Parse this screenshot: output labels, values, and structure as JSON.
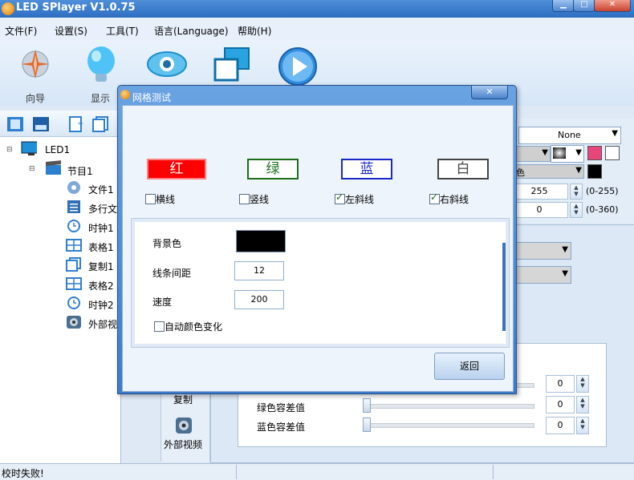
{
  "window": {
    "title": "LED SPlayer V1.0.75",
    "min": "▁",
    "max": "□",
    "close": "✕"
  },
  "menu": [
    "文件(F)",
    "设置(S)",
    "工具(T)",
    "语言(Language)",
    "帮助(H)"
  ],
  "toolbar": {
    "wizard": "向导",
    "display": "显示"
  },
  "tree": {
    "led": "LED1",
    "program": "节目1",
    "items": [
      "文件1",
      "多行文",
      "时钟1",
      "表格1",
      "复制1",
      "表格2",
      "时钟2",
      "外部视"
    ]
  },
  "right_panel": {
    "none_select": "None",
    "value1": "255",
    "range1": "(0-255)",
    "value2": "0",
    "range2": "(0-360)",
    "color_label": "色",
    "copy_label": "复制",
    "external_video": "外部视频",
    "green_tol_label": "绿色容差值",
    "blue_tol_label": "蓝色容差值",
    "tol_values": [
      "0",
      "0",
      "0"
    ]
  },
  "status": {
    "message": "校时失败!"
  },
  "dialog": {
    "title": "网格测试",
    "close": "✕",
    "colors": [
      {
        "label": "红",
        "bg": "#ff0000",
        "fg": "#ffffff",
        "border": "#ff8080"
      },
      {
        "label": "绿",
        "bg": "#ffffff",
        "fg": "#1a6e1a",
        "border": "#1a6e1a"
      },
      {
        "label": "蓝",
        "bg": "#ffffff",
        "fg": "#1a28c8",
        "border": "#1a28c8"
      },
      {
        "label": "白",
        "bg": "#ffffff",
        "fg": "#444444",
        "border": "#444444"
      }
    ],
    "checks": [
      {
        "label": "横线",
        "checked": false
      },
      {
        "label": "竖线",
        "checked": false
      },
      {
        "label": "左斜线",
        "checked": true
      },
      {
        "label": "右斜线",
        "checked": true
      }
    ],
    "bg_color_label": "背景色",
    "line_spacing_label": "线条间距",
    "line_spacing_value": "12",
    "speed_label": "速度",
    "speed_value": "200",
    "auto_color_label": "自动颜色变化",
    "auto_color_checked": false,
    "return_button": "返回"
  }
}
